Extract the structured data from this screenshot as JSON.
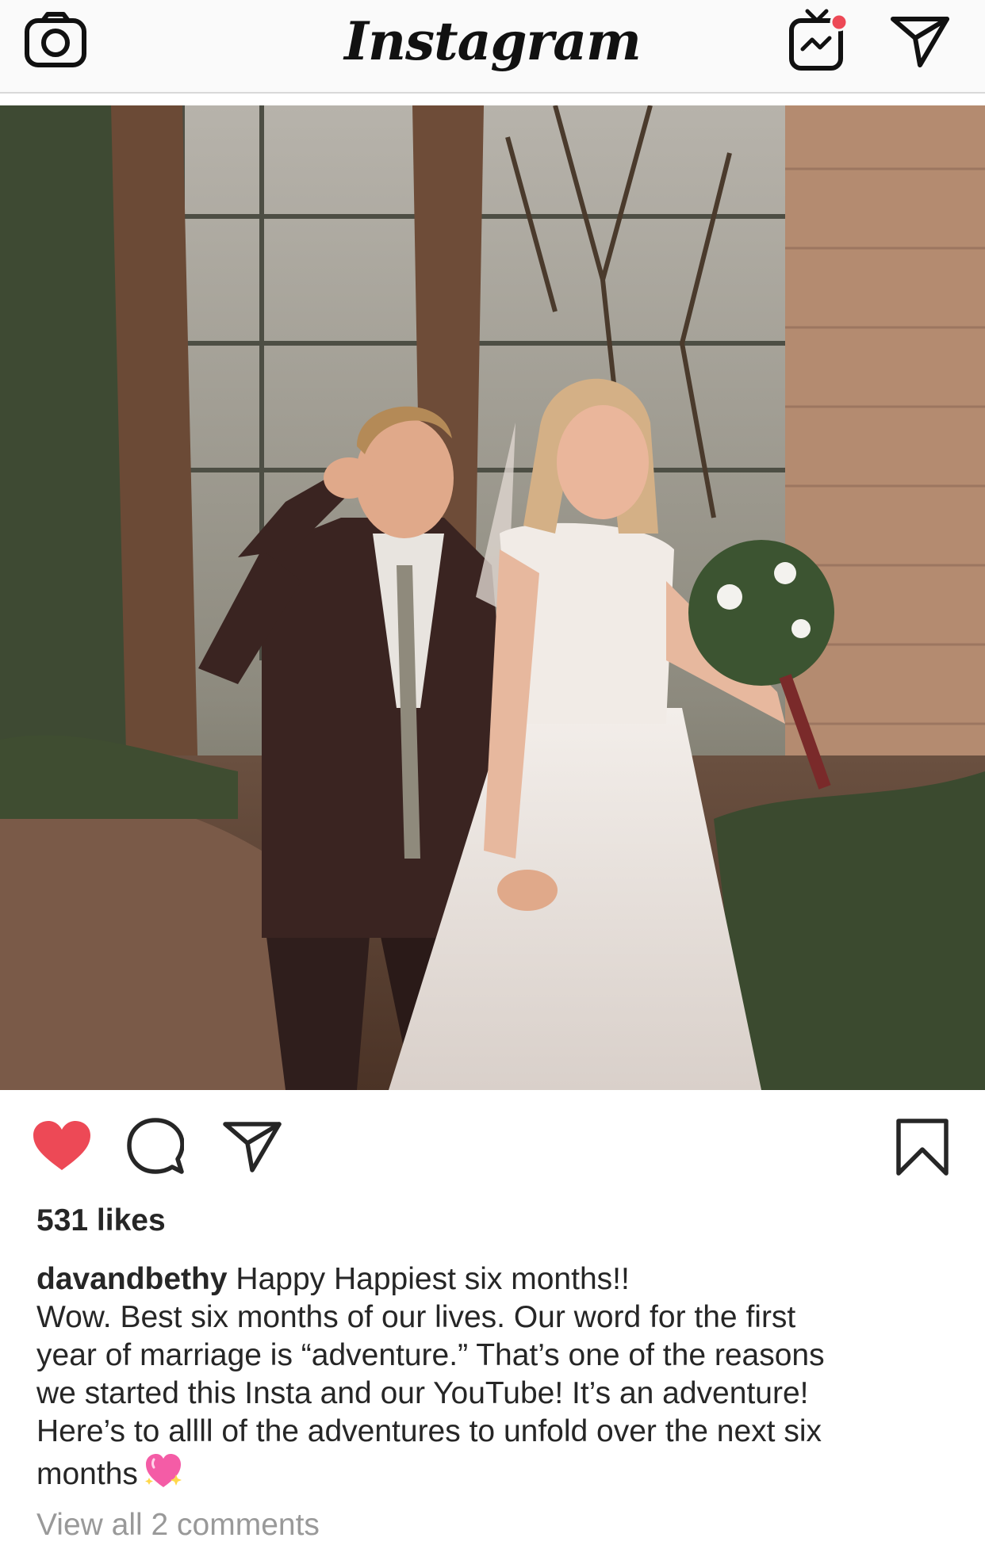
{
  "header": {
    "brand": "Instagram",
    "camera_icon": "camera-icon",
    "igtv_icon": "igtv-icon",
    "direct_icon": "paper-plane-icon",
    "igtv_badge_color": "#ed4956"
  },
  "post": {
    "photo": "wedding-couple-photo",
    "actions": {
      "like_icon": "heart-filled-icon",
      "like_color": "#ed4956",
      "comment_icon": "comment-bubble-icon",
      "share_icon": "paper-plane-icon",
      "save_icon": "bookmark-icon"
    },
    "likes": "531 likes",
    "caption": {
      "username": "davandbethy",
      "line1": "Happy Happiest six months!!",
      "line2": "Wow. Best six months of our lives. Our word for the first",
      "line3": "year of marriage is “adventure.” That’s one of the reasons",
      "line4": "we started this Insta and our YouTube! It’s an adventure!",
      "line5": "Here’s to allll of the adventures to unfold over the next six",
      "line6": "months",
      "emoji": "sparkling-heart-icon"
    },
    "view_comments": "View all 2 comments"
  }
}
